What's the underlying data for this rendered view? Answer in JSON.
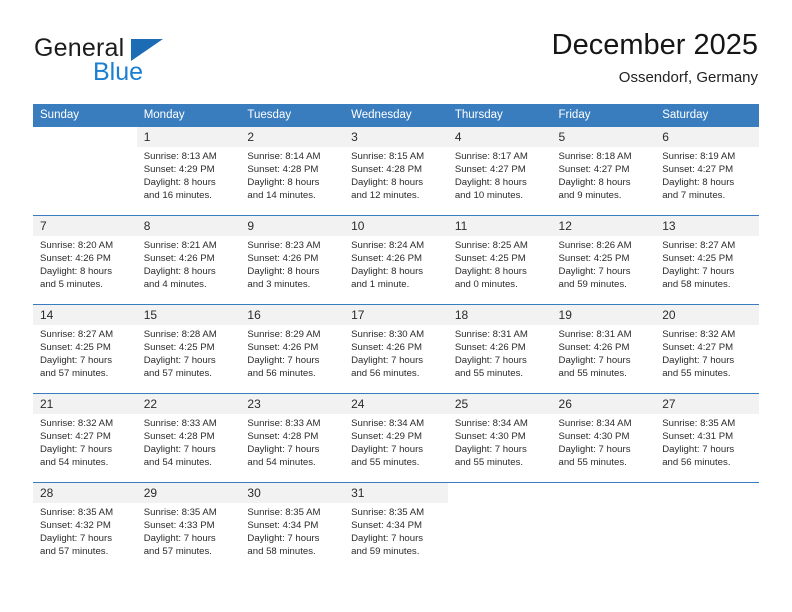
{
  "brand": {
    "name_top": "General",
    "name_bottom": "Blue",
    "accent_color": "#1b7ed1",
    "triangle_color": "#1b6cb5"
  },
  "header": {
    "title": "December 2025",
    "subtitle": "Ossendorf, Germany"
  },
  "theme": {
    "header_row_bg": "#3a7dbf",
    "header_row_text": "#ffffff",
    "daynum_bg": "#f2f2f2",
    "grid_line": "#3a7dbf",
    "body_text": "#2b2b2b"
  },
  "weekday_headers": [
    "Sunday",
    "Monday",
    "Tuesday",
    "Wednesday",
    "Thursday",
    "Friday",
    "Saturday"
  ],
  "weeks": [
    [
      {
        "day": "",
        "lines": []
      },
      {
        "day": "1",
        "lines": [
          "Sunrise: 8:13 AM",
          "Sunset: 4:29 PM",
          "Daylight: 8 hours",
          "and 16 minutes."
        ]
      },
      {
        "day": "2",
        "lines": [
          "Sunrise: 8:14 AM",
          "Sunset: 4:28 PM",
          "Daylight: 8 hours",
          "and 14 minutes."
        ]
      },
      {
        "day": "3",
        "lines": [
          "Sunrise: 8:15 AM",
          "Sunset: 4:28 PM",
          "Daylight: 8 hours",
          "and 12 minutes."
        ]
      },
      {
        "day": "4",
        "lines": [
          "Sunrise: 8:17 AM",
          "Sunset: 4:27 PM",
          "Daylight: 8 hours",
          "and 10 minutes."
        ]
      },
      {
        "day": "5",
        "lines": [
          "Sunrise: 8:18 AM",
          "Sunset: 4:27 PM",
          "Daylight: 8 hours",
          "and 9 minutes."
        ]
      },
      {
        "day": "6",
        "lines": [
          "Sunrise: 8:19 AM",
          "Sunset: 4:27 PM",
          "Daylight: 8 hours",
          "and 7 minutes."
        ]
      }
    ],
    [
      {
        "day": "7",
        "lines": [
          "Sunrise: 8:20 AM",
          "Sunset: 4:26 PM",
          "Daylight: 8 hours",
          "and 5 minutes."
        ]
      },
      {
        "day": "8",
        "lines": [
          "Sunrise: 8:21 AM",
          "Sunset: 4:26 PM",
          "Daylight: 8 hours",
          "and 4 minutes."
        ]
      },
      {
        "day": "9",
        "lines": [
          "Sunrise: 8:23 AM",
          "Sunset: 4:26 PM",
          "Daylight: 8 hours",
          "and 3 minutes."
        ]
      },
      {
        "day": "10",
        "lines": [
          "Sunrise: 8:24 AM",
          "Sunset: 4:26 PM",
          "Daylight: 8 hours",
          "and 1 minute."
        ]
      },
      {
        "day": "11",
        "lines": [
          "Sunrise: 8:25 AM",
          "Sunset: 4:25 PM",
          "Daylight: 8 hours",
          "and 0 minutes."
        ]
      },
      {
        "day": "12",
        "lines": [
          "Sunrise: 8:26 AM",
          "Sunset: 4:25 PM",
          "Daylight: 7 hours",
          "and 59 minutes."
        ]
      },
      {
        "day": "13",
        "lines": [
          "Sunrise: 8:27 AM",
          "Sunset: 4:25 PM",
          "Daylight: 7 hours",
          "and 58 minutes."
        ]
      }
    ],
    [
      {
        "day": "14",
        "lines": [
          "Sunrise: 8:27 AM",
          "Sunset: 4:25 PM",
          "Daylight: 7 hours",
          "and 57 minutes."
        ]
      },
      {
        "day": "15",
        "lines": [
          "Sunrise: 8:28 AM",
          "Sunset: 4:25 PM",
          "Daylight: 7 hours",
          "and 57 minutes."
        ]
      },
      {
        "day": "16",
        "lines": [
          "Sunrise: 8:29 AM",
          "Sunset: 4:26 PM",
          "Daylight: 7 hours",
          "and 56 minutes."
        ]
      },
      {
        "day": "17",
        "lines": [
          "Sunrise: 8:30 AM",
          "Sunset: 4:26 PM",
          "Daylight: 7 hours",
          "and 56 minutes."
        ]
      },
      {
        "day": "18",
        "lines": [
          "Sunrise: 8:31 AM",
          "Sunset: 4:26 PM",
          "Daylight: 7 hours",
          "and 55 minutes."
        ]
      },
      {
        "day": "19",
        "lines": [
          "Sunrise: 8:31 AM",
          "Sunset: 4:26 PM",
          "Daylight: 7 hours",
          "and 55 minutes."
        ]
      },
      {
        "day": "20",
        "lines": [
          "Sunrise: 8:32 AM",
          "Sunset: 4:27 PM",
          "Daylight: 7 hours",
          "and 55 minutes."
        ]
      }
    ],
    [
      {
        "day": "21",
        "lines": [
          "Sunrise: 8:32 AM",
          "Sunset: 4:27 PM",
          "Daylight: 7 hours",
          "and 54 minutes."
        ]
      },
      {
        "day": "22",
        "lines": [
          "Sunrise: 8:33 AM",
          "Sunset: 4:28 PM",
          "Daylight: 7 hours",
          "and 54 minutes."
        ]
      },
      {
        "day": "23",
        "lines": [
          "Sunrise: 8:33 AM",
          "Sunset: 4:28 PM",
          "Daylight: 7 hours",
          "and 54 minutes."
        ]
      },
      {
        "day": "24",
        "lines": [
          "Sunrise: 8:34 AM",
          "Sunset: 4:29 PM",
          "Daylight: 7 hours",
          "and 55 minutes."
        ]
      },
      {
        "day": "25",
        "lines": [
          "Sunrise: 8:34 AM",
          "Sunset: 4:30 PM",
          "Daylight: 7 hours",
          "and 55 minutes."
        ]
      },
      {
        "day": "26",
        "lines": [
          "Sunrise: 8:34 AM",
          "Sunset: 4:30 PM",
          "Daylight: 7 hours",
          "and 55 minutes."
        ]
      },
      {
        "day": "27",
        "lines": [
          "Sunrise: 8:35 AM",
          "Sunset: 4:31 PM",
          "Daylight: 7 hours",
          "and 56 minutes."
        ]
      }
    ],
    [
      {
        "day": "28",
        "lines": [
          "Sunrise: 8:35 AM",
          "Sunset: 4:32 PM",
          "Daylight: 7 hours",
          "and 57 minutes."
        ]
      },
      {
        "day": "29",
        "lines": [
          "Sunrise: 8:35 AM",
          "Sunset: 4:33 PM",
          "Daylight: 7 hours",
          "and 57 minutes."
        ]
      },
      {
        "day": "30",
        "lines": [
          "Sunrise: 8:35 AM",
          "Sunset: 4:34 PM",
          "Daylight: 7 hours",
          "and 58 minutes."
        ]
      },
      {
        "day": "31",
        "lines": [
          "Sunrise: 8:35 AM",
          "Sunset: 4:34 PM",
          "Daylight: 7 hours",
          "and 59 minutes."
        ]
      },
      {
        "day": "",
        "lines": []
      },
      {
        "day": "",
        "lines": []
      },
      {
        "day": "",
        "lines": []
      }
    ]
  ]
}
